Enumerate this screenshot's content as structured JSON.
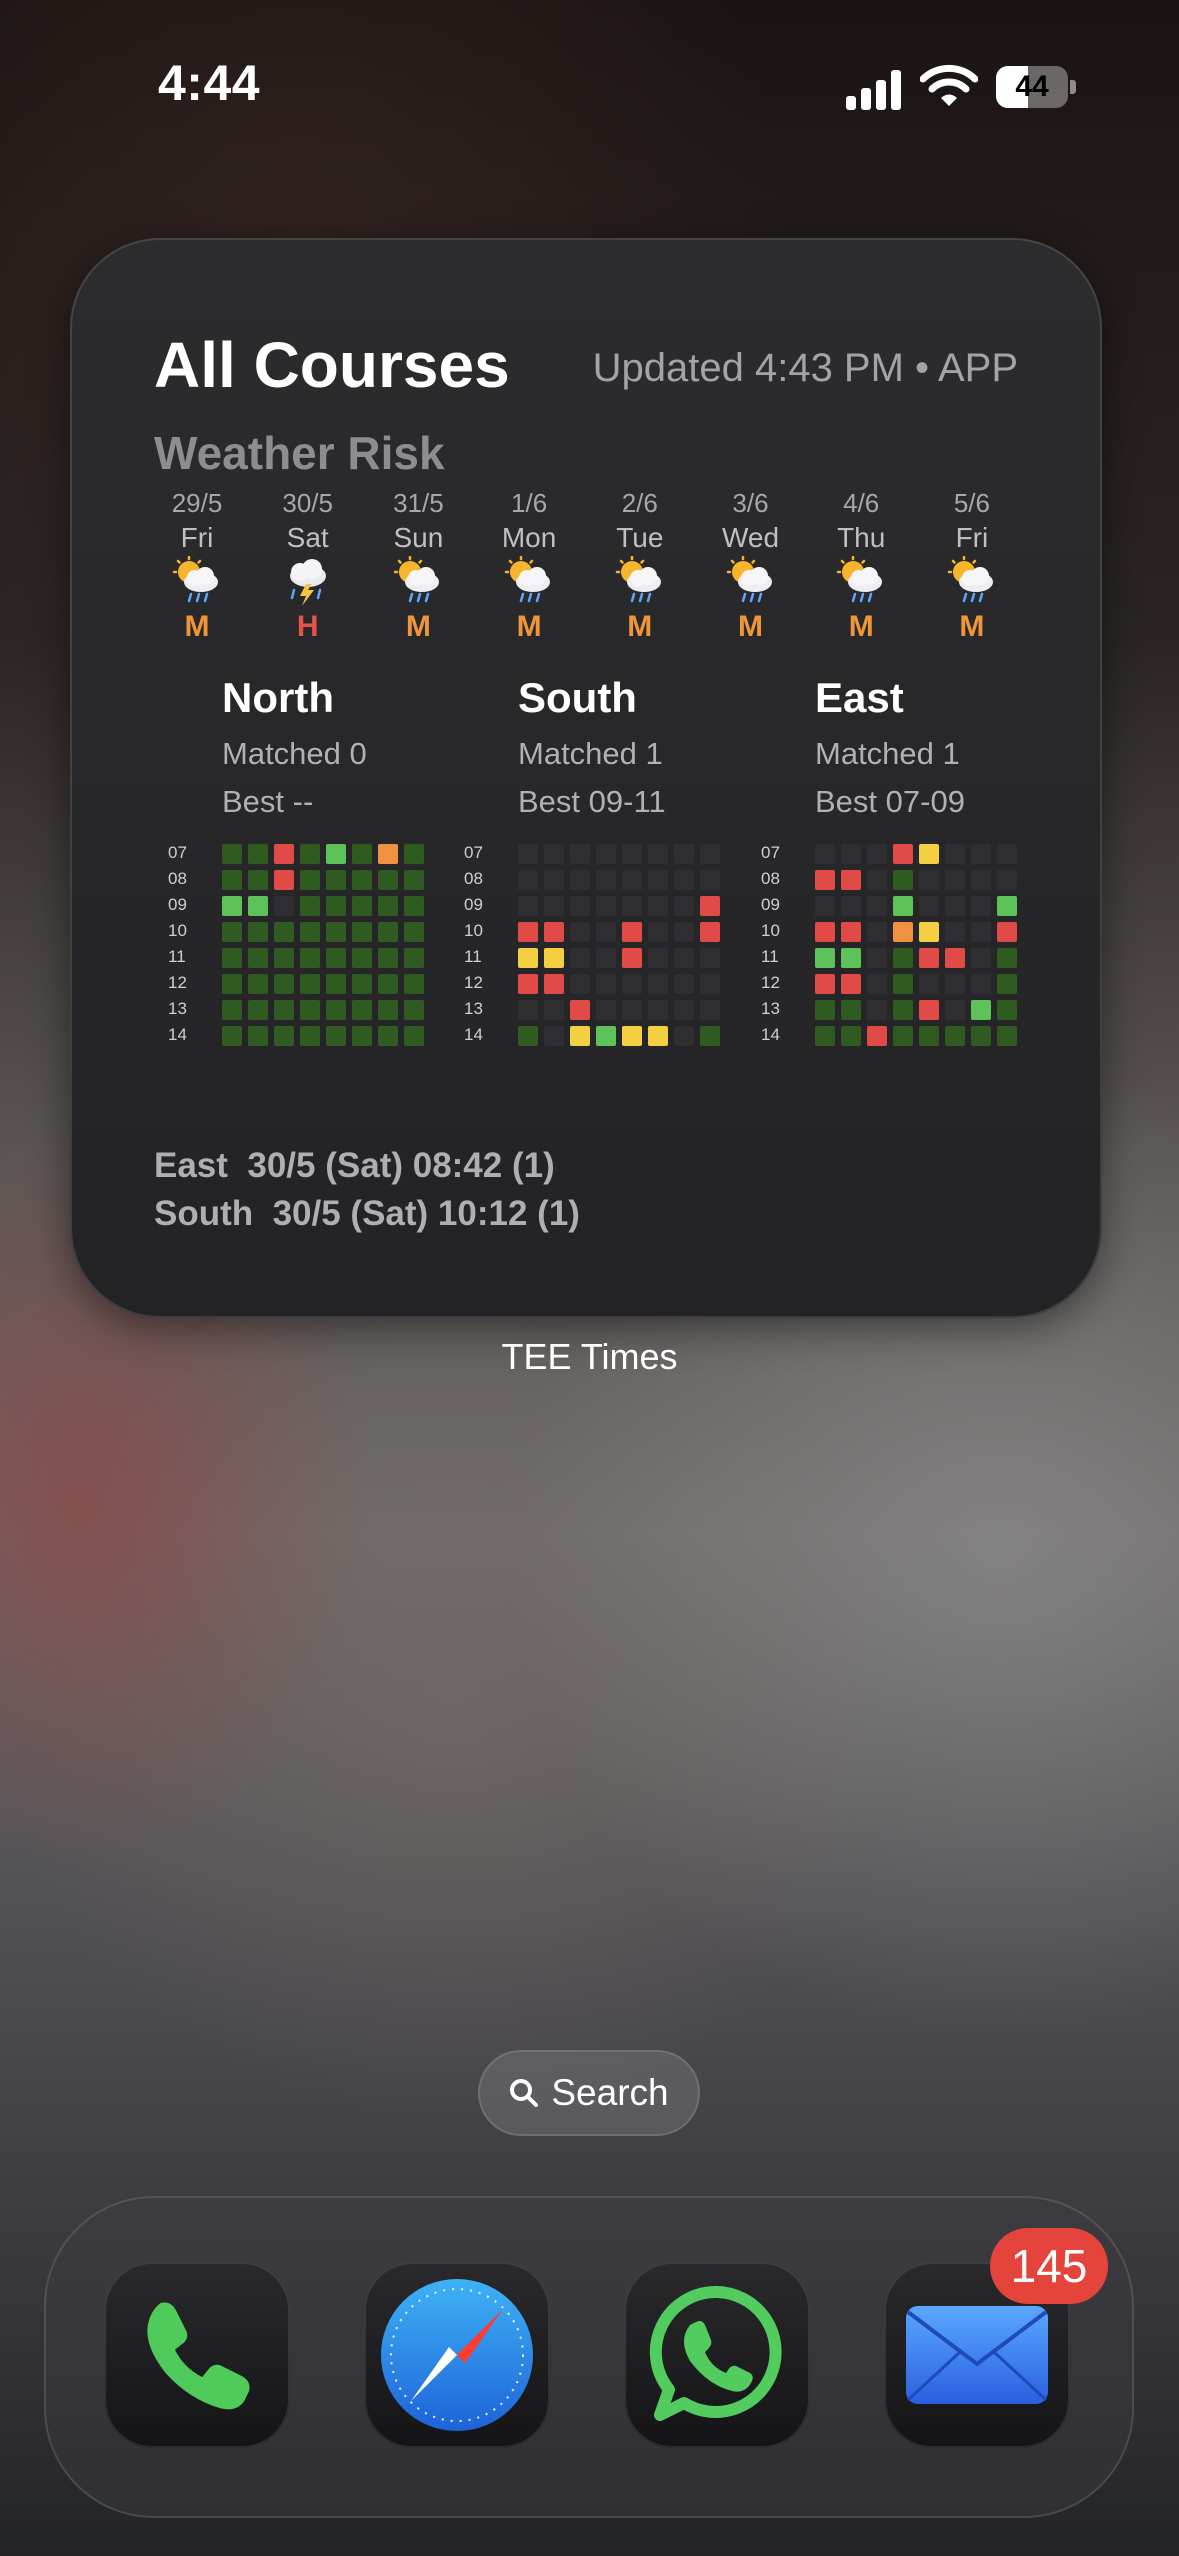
{
  "status_bar": {
    "time": "4:44",
    "battery": "44",
    "battery_level": 0.44
  },
  "widget": {
    "title": "All Courses",
    "updated": "Updated 4:43 PM • APP",
    "subtitle": "Weather Risk",
    "label": "TEE Times",
    "risk_colors": {
      "M": "#f0963a",
      "H": "#e5534b"
    },
    "days": [
      {
        "date": "29/5",
        "dow": "Fri",
        "icon": "sun-rain-icon",
        "risk": "M"
      },
      {
        "date": "30/5",
        "dow": "Sat",
        "icon": "thunderstorm-icon",
        "risk": "H"
      },
      {
        "date": "31/5",
        "dow": "Sun",
        "icon": "sun-rain-icon",
        "risk": "M"
      },
      {
        "date": "1/6",
        "dow": "Mon",
        "icon": "sun-rain-icon",
        "risk": "M"
      },
      {
        "date": "2/6",
        "dow": "Tue",
        "icon": "sun-rain-icon",
        "risk": "M"
      },
      {
        "date": "3/6",
        "dow": "Wed",
        "icon": "sun-rain-icon",
        "risk": "M"
      },
      {
        "date": "4/6",
        "dow": "Thu",
        "icon": "sun-rain-icon",
        "risk": "M"
      },
      {
        "date": "5/6",
        "dow": "Fri",
        "icon": "sun-rain-icon",
        "risk": "M"
      }
    ],
    "hours": [
      "07",
      "08",
      "09",
      "10",
      "11",
      "12",
      "13",
      "14"
    ],
    "cell_colors": {
      "d": "#2f2f32",
      "g": "#2f5a20",
      "G": "#5ec25a",
      "r": "#e04b48",
      "o": "#ee9140",
      "y": "#f3cf41"
    },
    "courses": [
      {
        "name": "North",
        "matched": "Matched 0",
        "best": "Best --",
        "grid": [
          "ggrgGgog",
          "ggrggggg",
          "GGdggggg",
          "gggggggg",
          "gggggggg",
          "gggggggg",
          "gggggggg",
          "gggggggg"
        ]
      },
      {
        "name": "South",
        "matched": "Matched 1",
        "best": "Best 09-11",
        "grid": [
          "dddddddd",
          "dddddddd",
          "dddddddr",
          "rrddrddr",
          "yyddrddd",
          "rrdddddd",
          "ddrddddd",
          "gdyGyydg"
        ]
      },
      {
        "name": "East",
        "matched": "Matched 1",
        "best": "Best 07-09",
        "grid": [
          "dddrydddr",
          "rrdgdddd",
          "dddGdddG",
          "rrdoyddr",
          "GGdgrrdg",
          "rrdgdddg",
          "ggdgrdGg",
          "ggrggggg"
        ]
      }
    ],
    "alerts": [
      "East  30/5 (Sat) 08:42 (1)",
      "South  30/5 (Sat) 10:12 (1)"
    ]
  },
  "search": {
    "label": "Search"
  },
  "dock": {
    "apps": [
      {
        "name": "Phone",
        "icon": "phone-icon"
      },
      {
        "name": "Safari",
        "icon": "compass-icon"
      },
      {
        "name": "WhatsApp",
        "icon": "whatsapp-icon"
      },
      {
        "name": "Mail",
        "icon": "envelope-icon"
      }
    ],
    "mail_badge": "145"
  }
}
